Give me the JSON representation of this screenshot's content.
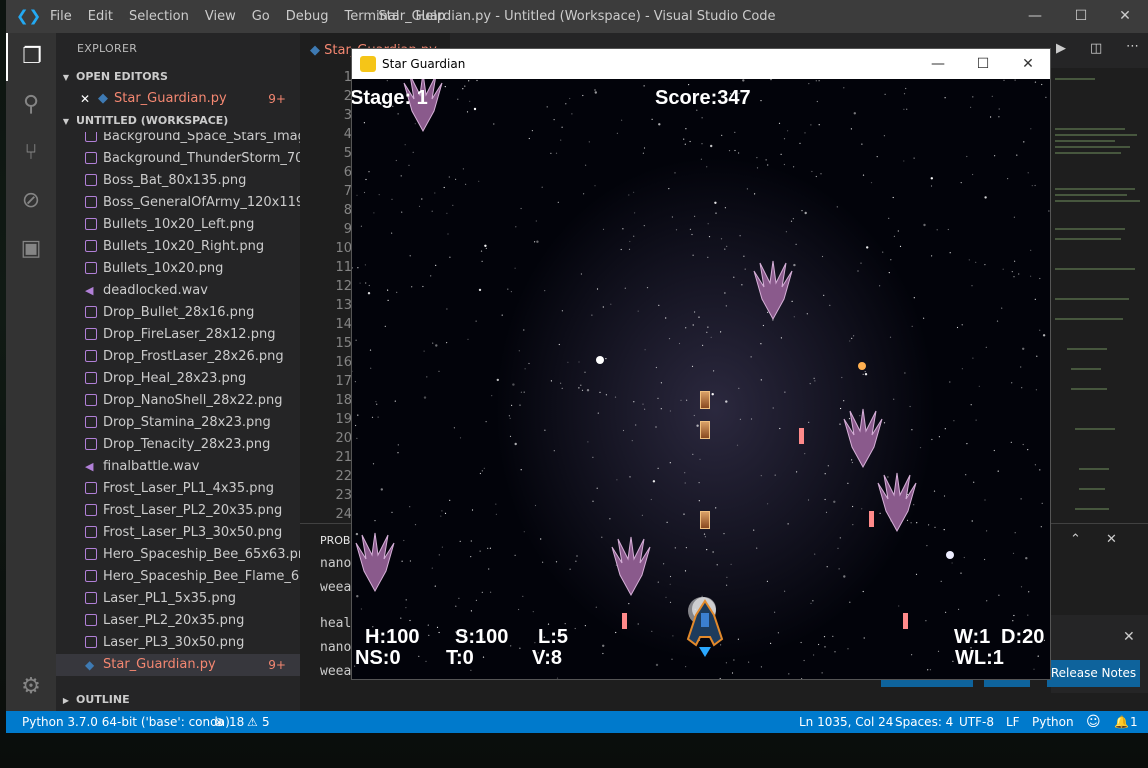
{
  "vscode": {
    "menu": [
      "File",
      "Edit",
      "Selection",
      "View",
      "Go",
      "Debug",
      "Terminal",
      "Help"
    ],
    "window_title": "Star_Guardian.py - Untitled (Workspace) - Visual Studio Code",
    "window_controls": [
      "—",
      "☐",
      "✕"
    ],
    "explorer_title": "EXPLORER",
    "open_editors_label": "OPEN EDITORS",
    "open_editor": {
      "name": "Star_Guardian.py",
      "problems": "9+"
    },
    "workspace_label": "UNTITLED (WORKSPACE)",
    "files": [
      {
        "name": "Background_Space_Stars_Image...",
        "type": "image"
      },
      {
        "name": "Background_ThunderStorm_700...",
        "type": "image"
      },
      {
        "name": "Boss_Bat_80x135.png",
        "type": "image"
      },
      {
        "name": "Boss_GeneralOfArmy_120x119.p...",
        "type": "image"
      },
      {
        "name": "Bullets_10x20_Left.png",
        "type": "image"
      },
      {
        "name": "Bullets_10x20_Right.png",
        "type": "image"
      },
      {
        "name": "Bullets_10x20.png",
        "type": "image"
      },
      {
        "name": "deadlocked.wav",
        "type": "audio"
      },
      {
        "name": "Drop_Bullet_28x16.png",
        "type": "image"
      },
      {
        "name": "Drop_FireLaser_28x12.png",
        "type": "image"
      },
      {
        "name": "Drop_FrostLaser_28x26.png",
        "type": "image"
      },
      {
        "name": "Drop_Heal_28x23.png",
        "type": "image"
      },
      {
        "name": "Drop_NanoShell_28x22.png",
        "type": "image"
      },
      {
        "name": "Drop_Stamina_28x23.png",
        "type": "image"
      },
      {
        "name": "Drop_Tenacity_28x23.png",
        "type": "image"
      },
      {
        "name": "finalbattle.wav",
        "type": "audio"
      },
      {
        "name": "Frost_Laser_PL1_4x35.png",
        "type": "image"
      },
      {
        "name": "Frost_Laser_PL2_20x35.png",
        "type": "image"
      },
      {
        "name": "Frost_Laser_PL3_30x50.png",
        "type": "image"
      },
      {
        "name": "Hero_Spaceship_Bee_65x63.png",
        "type": "image"
      },
      {
        "name": "Hero_Spaceship_Bee_Flame_65x...",
        "type": "image"
      },
      {
        "name": "Laser_PL1_5x35.png",
        "type": "image"
      },
      {
        "name": "Laser_PL2_20x35.png",
        "type": "image"
      },
      {
        "name": "Laser_PL3_30x50.png",
        "type": "image"
      },
      {
        "name": "Star_Guardian.py",
        "type": "python",
        "problems": "9+"
      }
    ],
    "outline_label": "OUTLINE",
    "tab_label": "Star_Guardian.py",
    "line_numbers": [
      "1",
      "2",
      "3",
      "4",
      "5",
      "6",
      "7",
      "8",
      "9",
      "10",
      "11",
      "12",
      "13",
      "14",
      "15",
      "16",
      "17",
      "18",
      "19",
      "20",
      "21",
      "22",
      "23",
      "24"
    ],
    "panel_title": "PROBL",
    "terminal_lines": [
      "nano",
      "weea",
      "",
      "heal",
      "nano",
      "weea"
    ],
    "release_notes_label": "Release Notes",
    "settings_badge": "1",
    "status": {
      "interpreter": "Python 3.7.0 64-bit ('base': conda)",
      "errors": "18",
      "warnings": "5",
      "position": "Ln 1035, Col 24",
      "spaces": "Spaces: 4",
      "encoding": "UTF-8",
      "eol": "LF",
      "language": "Python",
      "notifications": "1"
    }
  },
  "game": {
    "window_title": "Star Guardian",
    "window_controls": [
      "—",
      "☐",
      "✕"
    ],
    "hud": {
      "stage": "Stage: 1",
      "score": "Score:347",
      "health": "H:100",
      "stamina": "S:100",
      "laser": "L:5",
      "nanoshell": "NS:0",
      "tenacity": "T:0",
      "velocity": "V:8",
      "wave": "W:1",
      "damage": "D:20",
      "weapon_level": "WL:1"
    }
  }
}
